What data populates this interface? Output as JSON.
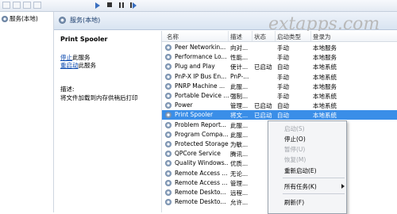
{
  "watermark": "extapps.com",
  "tree": {
    "label": "服务(本地)"
  },
  "header": {
    "title": "服务(本地)"
  },
  "details": {
    "service_name": "Print Spooler",
    "stop_link": "停止",
    "stop_suffix": "此服务",
    "restart_link": "重启动",
    "restart_suffix": "此服务",
    "desc_label": "描述:",
    "desc_text": "将文件加载到内存供稍后打印"
  },
  "columns": {
    "name": "名称",
    "desc": "描述",
    "status": "状态",
    "startup": "启动类型",
    "logon": "登录为"
  },
  "rows": [
    {
      "name": "Peer Networkin...",
      "desc": "向对...",
      "status": "",
      "startup": "手动",
      "logon": "本地服务"
    },
    {
      "name": "Performance Lo...",
      "desc": "性能...",
      "status": "",
      "startup": "手动",
      "logon": "本地服务"
    },
    {
      "name": "Plug and Play",
      "desc": "使计...",
      "status": "已启动",
      "startup": "自动",
      "logon": "本地系统"
    },
    {
      "name": "PnP-X IP Bus En...",
      "desc": "PnP-...",
      "status": "",
      "startup": "手动",
      "logon": "本地系统"
    },
    {
      "name": "PNRP Machine ...",
      "desc": "此服...",
      "status": "",
      "startup": "手动",
      "logon": "本地服务"
    },
    {
      "name": "Portable Device ...",
      "desc": "强制...",
      "status": "",
      "startup": "手动",
      "logon": "本地系统"
    },
    {
      "name": "Power",
      "desc": "管理...",
      "status": "已启动",
      "startup": "自动",
      "logon": "本地系统"
    },
    {
      "name": "Print Spooler",
      "desc": "将文...",
      "status": "已启动",
      "startup": "自动",
      "logon": "本地系统"
    },
    {
      "name": "Problem Report...",
      "desc": "此服...",
      "status": "",
      "startup": "",
      "logon": ""
    },
    {
      "name": "Program Compa...",
      "desc": "此服...",
      "status": "",
      "startup": "",
      "logon": ""
    },
    {
      "name": "Protected Storage",
      "desc": "为敏...",
      "status": "",
      "startup": "",
      "logon": ""
    },
    {
      "name": "QPCore Service",
      "desc": "腾讯...",
      "status": "",
      "startup": "",
      "logon": ""
    },
    {
      "name": "Quality Windows...",
      "desc": "优质...",
      "status": "",
      "startup": "",
      "logon": ""
    },
    {
      "name": "Remote Access ...",
      "desc": "无论...",
      "status": "",
      "startup": "",
      "logon": ""
    },
    {
      "name": "Remote Access ...",
      "desc": "管理...",
      "status": "",
      "startup": "",
      "logon": ""
    },
    {
      "name": "Remote Deskto...",
      "desc": "远程...",
      "status": "",
      "startup": "",
      "logon": ""
    },
    {
      "name": "Remote Deskto...",
      "desc": "允许...",
      "status": "",
      "startup": "",
      "logon": ""
    }
  ],
  "context_menu": {
    "start": "启动(S)",
    "stop": "停止(O)",
    "pause": "暂停(U)",
    "resume": "恢复(M)",
    "restart": "重新启动(E)",
    "all_tasks": "所有任务(K)",
    "refresh": "刷新(F)"
  }
}
